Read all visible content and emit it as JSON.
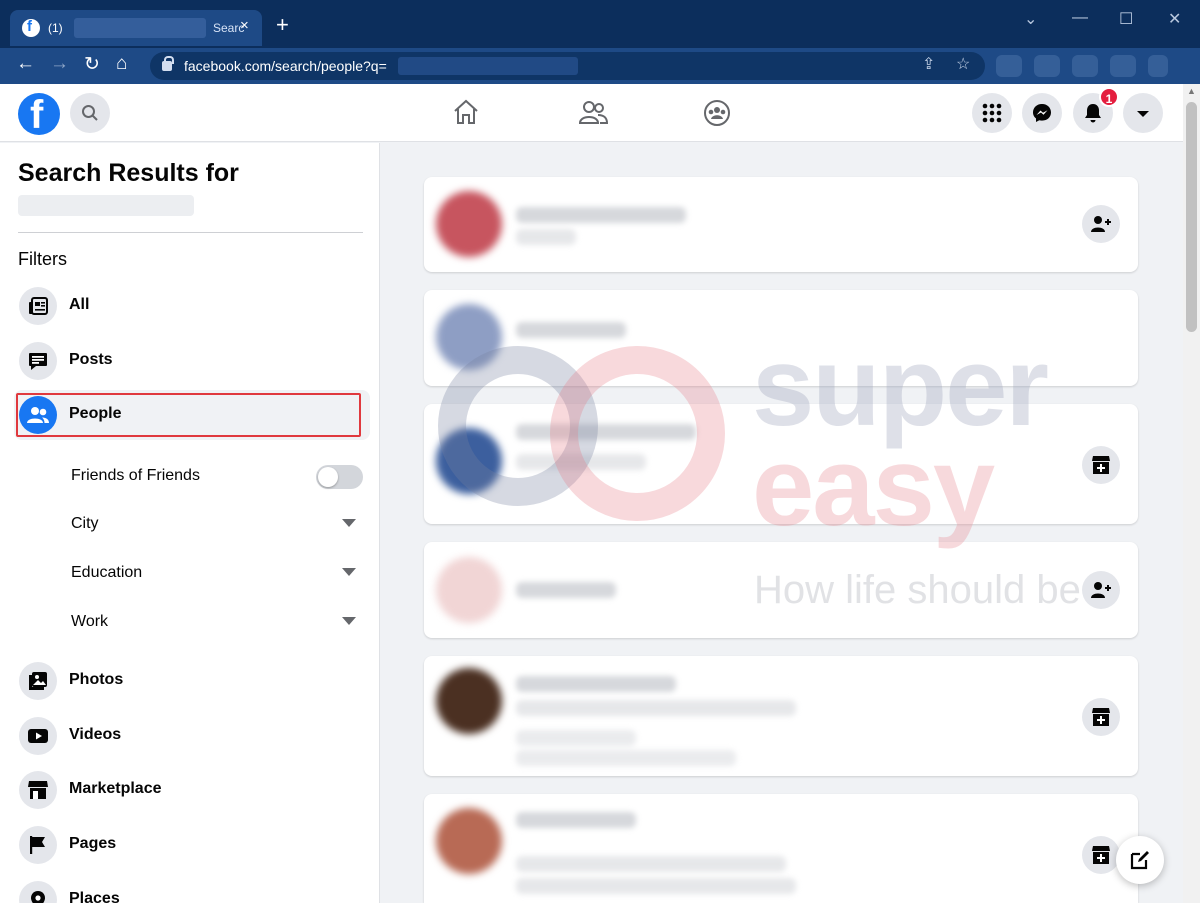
{
  "browser": {
    "tab_count_label": "(1)",
    "tab_title_visible": "Searc",
    "tab_close": "×",
    "new_tab": "+",
    "url": "facebook.com/search/people?q=",
    "win_minimize": "—",
    "win_restore": "☐",
    "win_close": "✕",
    "win_dropdown": "⌄"
  },
  "header": {
    "logo_letter": "f",
    "notification_count": "1",
    "accent": "#1877f2",
    "badge_color": "#e41e3f"
  },
  "sidebar": {
    "title": "Search Results for",
    "filters_heading": "Filters",
    "items": [
      {
        "label": "All",
        "icon": "newsfeed-icon"
      },
      {
        "label": "Posts",
        "icon": "posts-icon"
      },
      {
        "label": "People",
        "icon": "people-icon",
        "active": true
      },
      {
        "label": "Photos",
        "icon": "photos-icon"
      },
      {
        "label": "Videos",
        "icon": "videos-icon"
      },
      {
        "label": "Marketplace",
        "icon": "marketplace-icon"
      },
      {
        "label": "Pages",
        "icon": "pages-flag-icon"
      },
      {
        "label": "Places",
        "icon": "places-icon"
      }
    ],
    "people_subfilters": [
      {
        "label": "Friends of Friends",
        "control": "toggle",
        "value": "off"
      },
      {
        "label": "City",
        "control": "dropdown"
      },
      {
        "label": "Education",
        "control": "dropdown"
      },
      {
        "label": "Work",
        "control": "dropdown"
      }
    ]
  },
  "results": [
    {
      "action_icon": "add-friend-icon"
    },
    {
      "action_icon": "none"
    },
    {
      "action_icon": "follow-page-icon"
    },
    {
      "action_icon": "add-friend-icon"
    },
    {
      "action_icon": "follow-page-icon"
    },
    {
      "action_icon": "follow-page-icon"
    }
  ],
  "watermark": {
    "word1": "super",
    "word2": "easy",
    "tagline": "How life should be"
  }
}
